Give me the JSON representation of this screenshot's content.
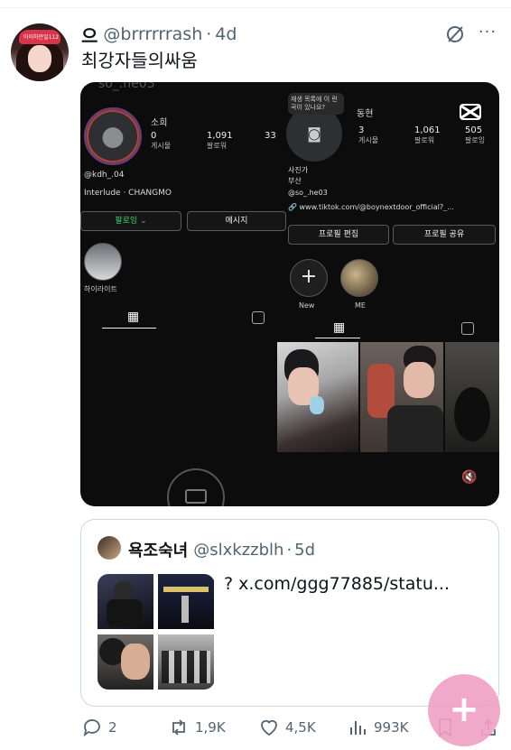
{
  "tweet": {
    "avatar_text": "아이하얀일112",
    "display_name": "으",
    "handle": "@brrrrrrash",
    "separator": "·",
    "time": "4d",
    "text": "최강자들의싸움"
  },
  "media": {
    "ghost_text": "so_.he03",
    "left_profile": {
      "name": "소희",
      "posts": "0",
      "posts_label": "게시물",
      "followers": "1,091",
      "followers_label": "팔로워",
      "following": "33",
      "username": "@kdh_.04",
      "music": "Interlude · CHANGMO",
      "follow_button": "팔로잉 ⌄",
      "message_button": "메시지",
      "highlight_label": "하이라이트"
    },
    "right_profile": {
      "tooltip": "재생 목록에 이 런 곡이 있나요?",
      "name": "동현",
      "posts": "3",
      "posts_label": "게시물",
      "followers": "1,061",
      "followers_label": "팔로워",
      "following": "505",
      "following_label": "팔로잉",
      "bio_line1": "사진가",
      "bio_line2": "부산",
      "username": "@so_.he03",
      "link": "www.tiktok.com/@boynextdoor_official?_...",
      "edit_button": "프로필 편집",
      "share_button": "프로필 공유",
      "highlight_new": "New",
      "highlight_me": "ME"
    },
    "accent_colors": {
      "follow_green": "#3fcf6a",
      "ring": "#b4432f"
    }
  },
  "quote": {
    "display_name": "욕조숙녀",
    "handle": "@slxkzzblh",
    "separator": "·",
    "time": "5d",
    "text": "? x.com/ggg77885/statu..."
  },
  "actions": {
    "replies": "2",
    "retweets": "1,9K",
    "likes": "4,5K",
    "views": "993K"
  },
  "fab": {
    "label": "+"
  }
}
